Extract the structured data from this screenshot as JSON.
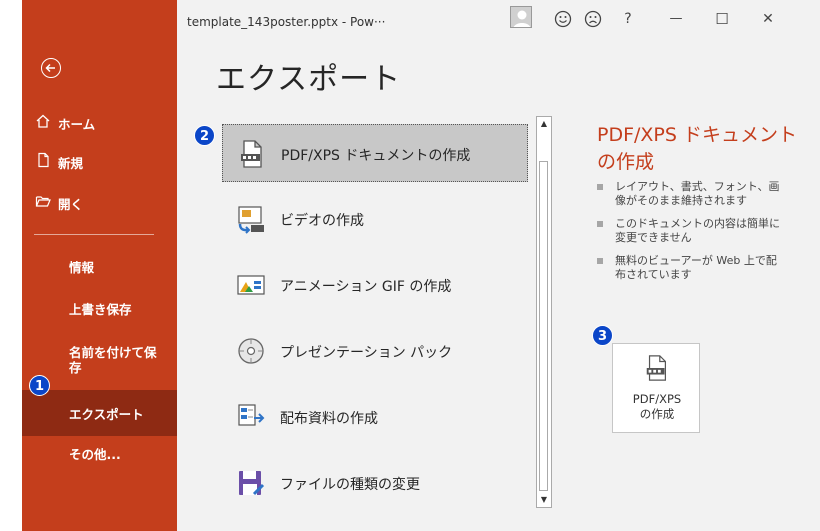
{
  "window": {
    "doc_title": "template_143poster.pptx  -  Pow···",
    "help": "?",
    "minimize": "—",
    "maximize": "☐",
    "close": "✕"
  },
  "sidebar": {
    "home": "ホーム",
    "new": "新規",
    "open": "開く",
    "info": "情報",
    "save": "上書き保存",
    "save_as_line1": "名前を付けて保",
    "save_as_line2": "存",
    "export": "エクスポート",
    "more": "その他..."
  },
  "badges": {
    "b1": "1",
    "b2": "2",
    "b3": "3"
  },
  "page_title": "エクスポート",
  "export_options": [
    {
      "label": "PDF/XPS ドキュメントの作成",
      "icon": "pdf-document-icon",
      "selected": true
    },
    {
      "label": "ビデオの作成",
      "icon": "video-icon",
      "selected": false
    },
    {
      "label": "アニメーション GIF の作成",
      "icon": "animated-gif-icon",
      "selected": false
    },
    {
      "label": "プレゼンテーション パック",
      "icon": "cd-package-icon",
      "selected": false
    },
    {
      "label": "配布資料の作成",
      "icon": "handouts-icon",
      "selected": false
    },
    {
      "label": "ファイルの種類の変更",
      "icon": "change-file-type-icon",
      "selected": false
    }
  ],
  "detail": {
    "title": "PDF/XPS ドキュメントの作成",
    "bullets": [
      "レイアウト、書式、フォント、画像がそのまま維持されます",
      "このドキュメントの内容は簡単に変更できません",
      "無料のビューアーが Web 上で配布されています"
    ],
    "button_label": "PDF/XPS\nの作成"
  },
  "colors": {
    "sidebar": "#c43e1c",
    "sidebar_active": "#8e2a13",
    "accent": "#c43e1c",
    "badge": "#0b46c8"
  }
}
